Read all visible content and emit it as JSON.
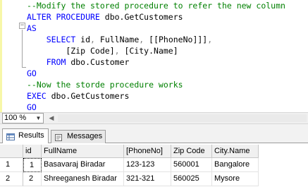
{
  "editor": {
    "lines": [
      {
        "parts": [
          {
            "c": "cm",
            "t": "--Modify the stored procedure to refer the new column"
          }
        ]
      },
      {
        "parts": [
          {
            "c": "kw",
            "t": "ALTER PROCEDURE "
          },
          {
            "c": "tx",
            "t": "dbo.GetCustomers"
          }
        ]
      },
      {
        "parts": [
          {
            "c": "kw",
            "t": "AS"
          }
        ]
      },
      {
        "parts": [
          {
            "c": "tx",
            "t": "    "
          },
          {
            "c": "kw",
            "t": "SELECT "
          },
          {
            "c": "tx",
            "t": "id"
          },
          {
            "c": "gy",
            "t": ", "
          },
          {
            "c": "tx",
            "t": "FullName"
          },
          {
            "c": "gy",
            "t": ", "
          },
          {
            "c": "tx",
            "t": "[[PhoneNo]]]"
          },
          {
            "c": "gy",
            "t": ","
          }
        ]
      },
      {
        "parts": [
          {
            "c": "tx",
            "t": "        [Zip Code]"
          },
          {
            "c": "gy",
            "t": ", "
          },
          {
            "c": "tx",
            "t": "[City.Name]"
          }
        ]
      },
      {
        "parts": [
          {
            "c": "tx",
            "t": "    "
          },
          {
            "c": "kw",
            "t": "FROM "
          },
          {
            "c": "tx",
            "t": "dbo.Customer"
          }
        ]
      },
      {
        "parts": [
          {
            "c": "kw",
            "t": "GO"
          }
        ]
      },
      {
        "parts": [
          {
            "c": "cm",
            "t": "--Now the storde procedure works"
          }
        ]
      },
      {
        "parts": [
          {
            "c": "kw",
            "t": "EXEC "
          },
          {
            "c": "tx",
            "t": "dbo.GetCustomers"
          }
        ]
      },
      {
        "parts": [
          {
            "c": "kw",
            "t": "GO"
          }
        ]
      }
    ]
  },
  "zoom": {
    "value": "100 %"
  },
  "tabs": {
    "results": "Results",
    "messages": "Messages"
  },
  "grid": {
    "columns": [
      "id",
      "FullName",
      "[PhoneNo]",
      "Zip Code",
      "City.Name"
    ],
    "rows": [
      {
        "num": "1",
        "cells": [
          "1",
          "Basavaraj Biradar",
          "123-123",
          "560001",
          "Bangalore"
        ]
      },
      {
        "num": "2",
        "cells": [
          "2",
          "Shreeganesh Biradar",
          "321-321",
          "560025",
          "Mysore"
        ]
      }
    ]
  },
  "colors": {
    "keyword": "#0000ff",
    "comment": "#008000",
    "operator": "#808080"
  }
}
